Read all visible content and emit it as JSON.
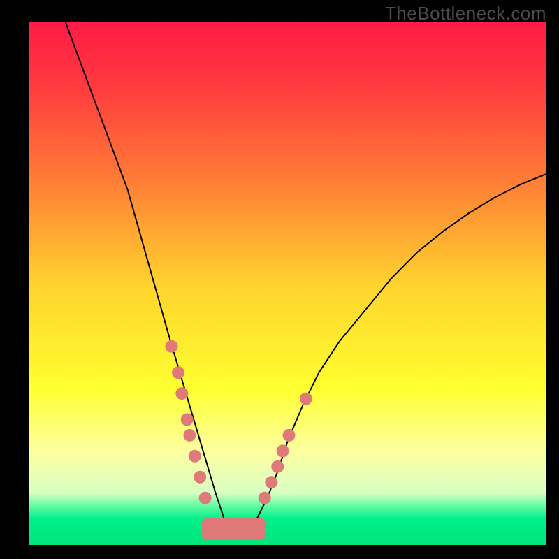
{
  "watermark": "TheBottleneck.com",
  "chart_data": {
    "type": "line",
    "title": "",
    "xlabel": "",
    "ylabel": "",
    "xlim": [
      0,
      100
    ],
    "ylim": [
      0,
      100
    ],
    "grid": false,
    "legend": false,
    "background": {
      "type": "vertical-gradient",
      "stops": [
        {
          "offset": 0.0,
          "color": "#ff1b46"
        },
        {
          "offset": 0.12,
          "color": "#ff3a3f"
        },
        {
          "offset": 0.3,
          "color": "#ff7c36"
        },
        {
          "offset": 0.5,
          "color": "#ffd22e"
        },
        {
          "offset": 0.7,
          "color": "#ffff2f"
        },
        {
          "offset": 0.82,
          "color": "#fdffa0"
        },
        {
          "offset": 0.9,
          "color": "#d8ffc2"
        },
        {
          "offset": 0.92,
          "color": "#7affa8"
        },
        {
          "offset": 0.95,
          "color": "#00f08a"
        },
        {
          "offset": 1.0,
          "color": "#00e57a"
        }
      ]
    },
    "series": [
      {
        "name": "bottleneck-curve",
        "x": [
          7,
          10,
          13,
          16,
          19,
          21,
          23,
          25,
          27,
          28.5,
          30,
          31.5,
          33,
          34.5,
          36,
          37,
          38,
          39,
          41,
          42.5,
          44,
          46,
          48,
          50,
          53,
          56,
          60,
          65,
          70,
          75,
          80,
          85,
          90,
          95,
          100
        ],
        "y": [
          100,
          92,
          84,
          76,
          68,
          61,
          54,
          47,
          40,
          35,
          30,
          25,
          20,
          15,
          10,
          7,
          4,
          2,
          2,
          3,
          5,
          9,
          14,
          20,
          27,
          33,
          39,
          45,
          51,
          56,
          60,
          63.5,
          66.5,
          69,
          71
        ]
      }
    ],
    "markers": {
      "name": "highlight-dots",
      "color": "#e07a7a",
      "radius_px": 9,
      "points": [
        {
          "x": 27.5,
          "y": 38
        },
        {
          "x": 28.8,
          "y": 33
        },
        {
          "x": 29.5,
          "y": 29
        },
        {
          "x": 30.5,
          "y": 24
        },
        {
          "x": 31.0,
          "y": 21
        },
        {
          "x": 32.0,
          "y": 17
        },
        {
          "x": 33.0,
          "y": 13
        },
        {
          "x": 34.0,
          "y": 9
        },
        {
          "x": 45.5,
          "y": 9
        },
        {
          "x": 46.8,
          "y": 12
        },
        {
          "x": 48.0,
          "y": 15
        },
        {
          "x": 49.0,
          "y": 18
        },
        {
          "x": 50.2,
          "y": 21
        },
        {
          "x": 53.5,
          "y": 28
        }
      ]
    },
    "valley_fill": {
      "name": "valley-pink-band",
      "color": "#e07a7a",
      "points_x": [
        34.5,
        35.5,
        36.5,
        37.5,
        38.5,
        39.5,
        40.5,
        41.5,
        42.5,
        43.5,
        44.5
      ],
      "y_top": 1.2,
      "y_bottom": 6.5
    }
  }
}
